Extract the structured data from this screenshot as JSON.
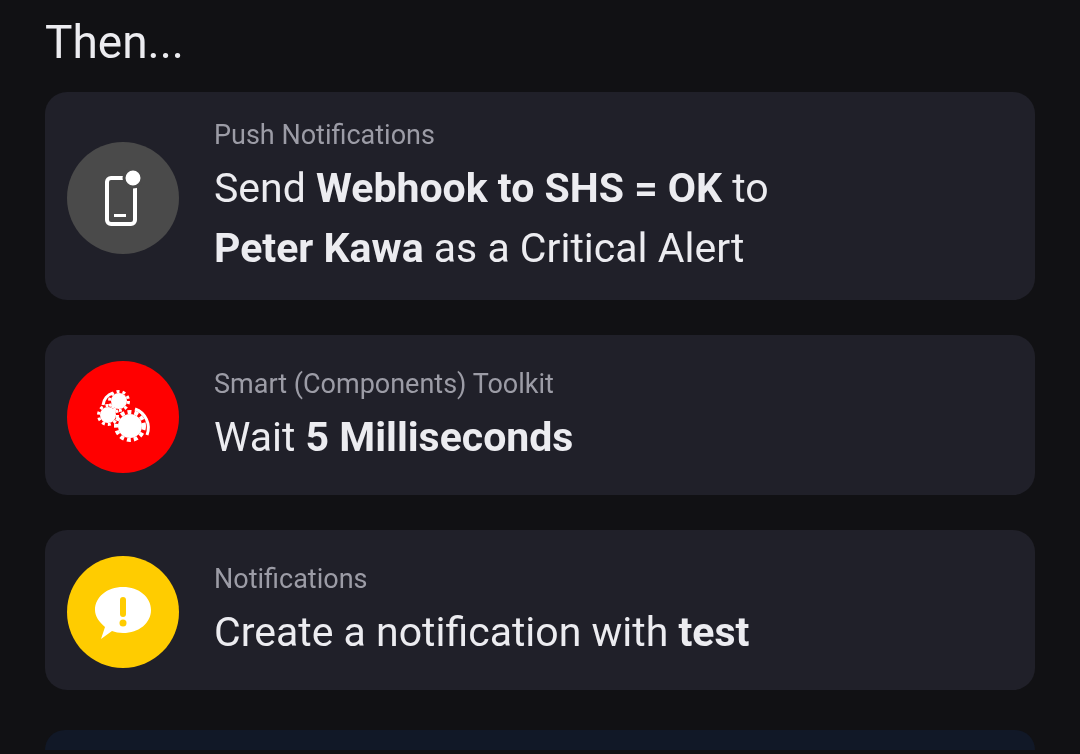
{
  "heading": "Then...",
  "actions": [
    {
      "kind": "phone",
      "color": "#4a4a4a",
      "category": "Push Notifications",
      "text": "Send **Webhook to SHS = OK** to **Peter Kawa** as a Critical Alert"
    },
    {
      "kind": "gears",
      "color": "#ff0000",
      "category": "Smart (Components) Toolkit",
      "text": "Wait **5  Milliseconds**"
    },
    {
      "kind": "alert",
      "color": "#ffcc00",
      "category": "Notifications",
      "text": "Create a notification with **test**"
    }
  ]
}
